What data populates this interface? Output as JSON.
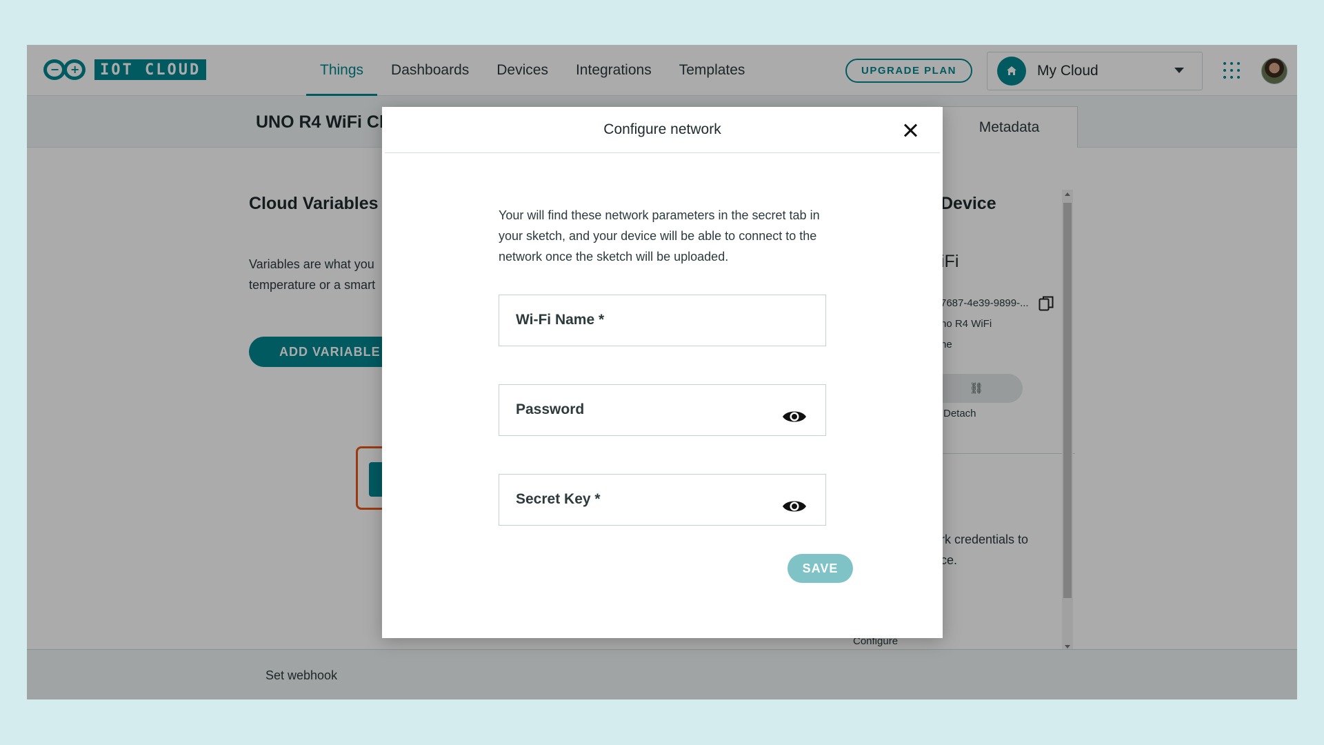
{
  "app": {
    "logo_text": "IOT CLOUD",
    "nav": [
      "Things",
      "Dashboards",
      "Devices",
      "Integrations",
      "Templates"
    ],
    "active_nav": "Things",
    "upgrade_label": "UPGRADE PLAN",
    "space_label": "My Cloud",
    "accent_color": "#00878f"
  },
  "thing": {
    "title": "UNO R4 WiFi Cl",
    "metadata_tab": "Metadata"
  },
  "cloud_variables": {
    "title": "Cloud Variables",
    "description_line1": "Variables are what you",
    "description_line2": "temperature or a smart",
    "add_button": "ADD VARIABLE"
  },
  "device_panel": {
    "title": "Device",
    "name": "iFi",
    "id": "7687-4e39-9899-...",
    "type": "no R4 WiFi",
    "status": "ne",
    "detach_icon": "⛓",
    "detach_label": "Detach",
    "network_text_line1": "rk credentials to",
    "network_text_line2": "ce.",
    "configure_label": "Configure"
  },
  "bottom": {
    "webhook_label": "Set webhook"
  },
  "modal": {
    "title": "Configure network",
    "description": "Your will find these network parameters in the secret tab in your sketch, and your device will be able to connect to the network once the sketch will be uploaded.",
    "fields": [
      {
        "label": "Wi-Fi Name *",
        "has_eye": false
      },
      {
        "label": "Password",
        "has_eye": true
      },
      {
        "label": "Secret Key *",
        "has_eye": true
      }
    ],
    "save_label": "SAVE"
  }
}
